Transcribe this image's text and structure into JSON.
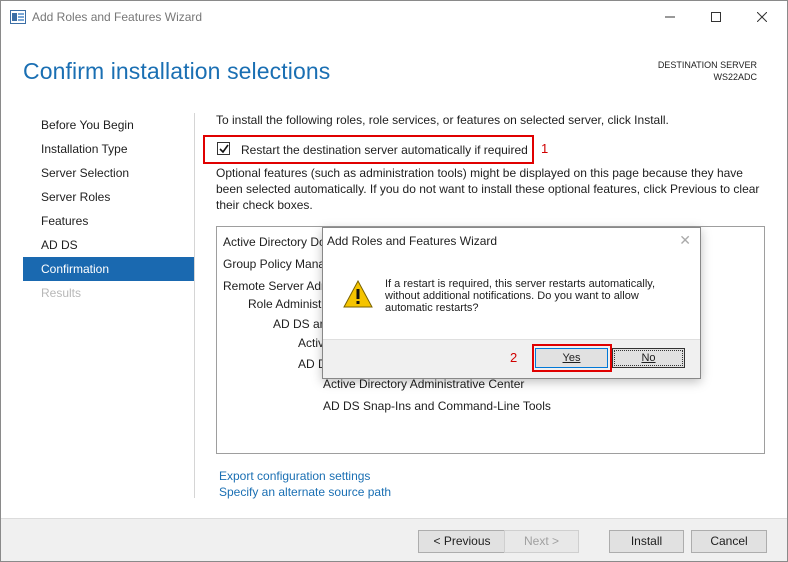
{
  "window": {
    "title": "Add Roles and Features Wizard",
    "heading": "Confirm installation selections",
    "destination_label": "DESTINATION SERVER",
    "destination_server": "WS22ADC"
  },
  "nav": {
    "items": [
      {
        "label": "Before You Begin",
        "state": "normal"
      },
      {
        "label": "Installation Type",
        "state": "normal"
      },
      {
        "label": "Server Selection",
        "state": "normal"
      },
      {
        "label": "Server Roles",
        "state": "normal"
      },
      {
        "label": "Features",
        "state": "normal"
      },
      {
        "label": "AD DS",
        "state": "normal"
      },
      {
        "label": "Confirmation",
        "state": "active"
      },
      {
        "label": "Results",
        "state": "disabled"
      }
    ]
  },
  "content": {
    "intro": "To install the following roles, role services, or features on selected server, click Install.",
    "restart_label": "Restart the destination server automatically if required",
    "restart_checked": true,
    "annotation_1": "1",
    "optional_text": "Optional features (such as administration tools) might be displayed on this page because they have been selected automatically. If you do not want to install these optional features, click Previous to clear their check boxes.",
    "features": [
      "Active Directory Do",
      "Group Policy Mana",
      "Remote Server Adr",
      "Role Administ",
      "AD DS an",
      "Activ",
      "AD D",
      "Active Directory Administrative Center",
      "AD DS Snap-Ins and Command-Line Tools"
    ],
    "export_link": "Export configuration settings",
    "source_link": "Specify an alternate source path"
  },
  "footer": {
    "previous": "< Previous",
    "next": "Next >",
    "install": "Install",
    "cancel": "Cancel"
  },
  "dialog": {
    "title": "Add Roles and Features Wizard",
    "close_glyph": "✕",
    "message": "If a restart is required, this server restarts automatically, without additional notifications. Do you want to allow automatic restarts?",
    "annotation_2": "2",
    "yes": "Yes",
    "no": "No"
  },
  "colors": {
    "accent": "#1a6fb3",
    "nav_active": "#1a69b0",
    "annotation_red": "#e00000",
    "warning_yellow": "#f5c400"
  }
}
